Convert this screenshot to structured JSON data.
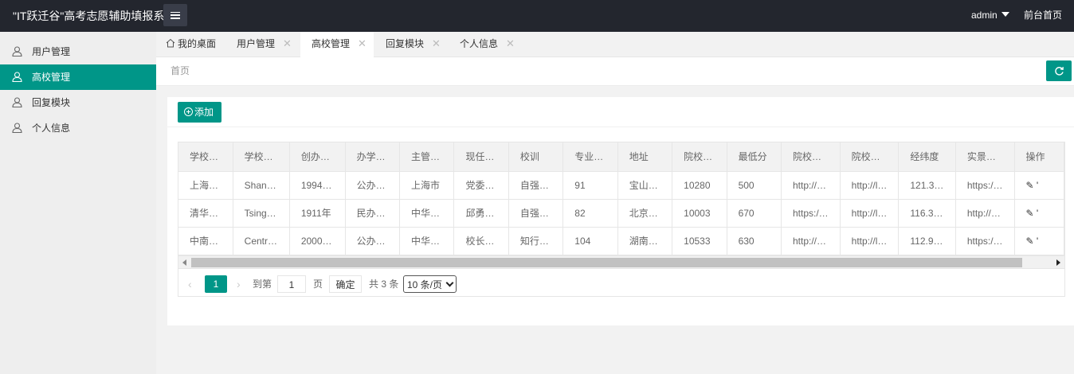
{
  "header": {
    "title": "\"IT跃迁谷\"高考志愿辅助填报系",
    "user": "admin",
    "home_link": "前台首页"
  },
  "sidebar": {
    "items": [
      {
        "label": "用户管理",
        "active": false
      },
      {
        "label": "高校管理",
        "active": true
      },
      {
        "label": "回复模块",
        "active": false
      },
      {
        "label": "个人信息",
        "active": false
      }
    ]
  },
  "tabs": [
    {
      "label": "我的桌面",
      "active": false
    },
    {
      "label": "用户管理",
      "active": false
    },
    {
      "label": "高校管理",
      "active": true
    },
    {
      "label": "回复模块",
      "active": false
    },
    {
      "label": "个人信息",
      "active": false
    }
  ],
  "breadcrumb": "首页",
  "toolbar": {
    "add_label": "添加"
  },
  "table": {
    "columns": [
      "学校…",
      "学校…",
      "创办…",
      "办学…",
      "主管…",
      "现任…",
      "校训",
      "专业…",
      "地址",
      "院校…",
      "最低分",
      "院校…",
      "院校…",
      "经纬度",
      "实景…",
      "操作"
    ],
    "rows": [
      [
        "上海…",
        "Shan…",
        "1994…",
        "公办…",
        "上海市",
        "党委…",
        "自强…",
        "91",
        "宝山…",
        "10280",
        "500",
        "http://…",
        "http://l…",
        "121.3…",
        "https:/…",
        "✎ '"
      ],
      [
        "清华…",
        "Tsing…",
        "1911年",
        "民办…",
        "中华…",
        "邱勇…",
        "自强…",
        "82",
        "北京…",
        "10003",
        "670",
        "https:/…",
        "http://l…",
        "116.3…",
        "http://…",
        "✎ '"
      ],
      [
        "中南…",
        "Centr…",
        "2000…",
        "公办…",
        "中华…",
        "校长…",
        "知行…",
        "104",
        "湖南…",
        "10533",
        "630",
        "http://…",
        "http://l…",
        "112.9…",
        "https:/…",
        "✎ '"
      ]
    ]
  },
  "pagination": {
    "current_page": "1",
    "goto_label": "到第",
    "goto_value": "1",
    "page_unit": "页",
    "confirm_label": "确定",
    "total_label": "共 3 条",
    "page_size": "10 条/页"
  },
  "colors": {
    "accent": "#009688",
    "header_bg": "#23262e"
  }
}
